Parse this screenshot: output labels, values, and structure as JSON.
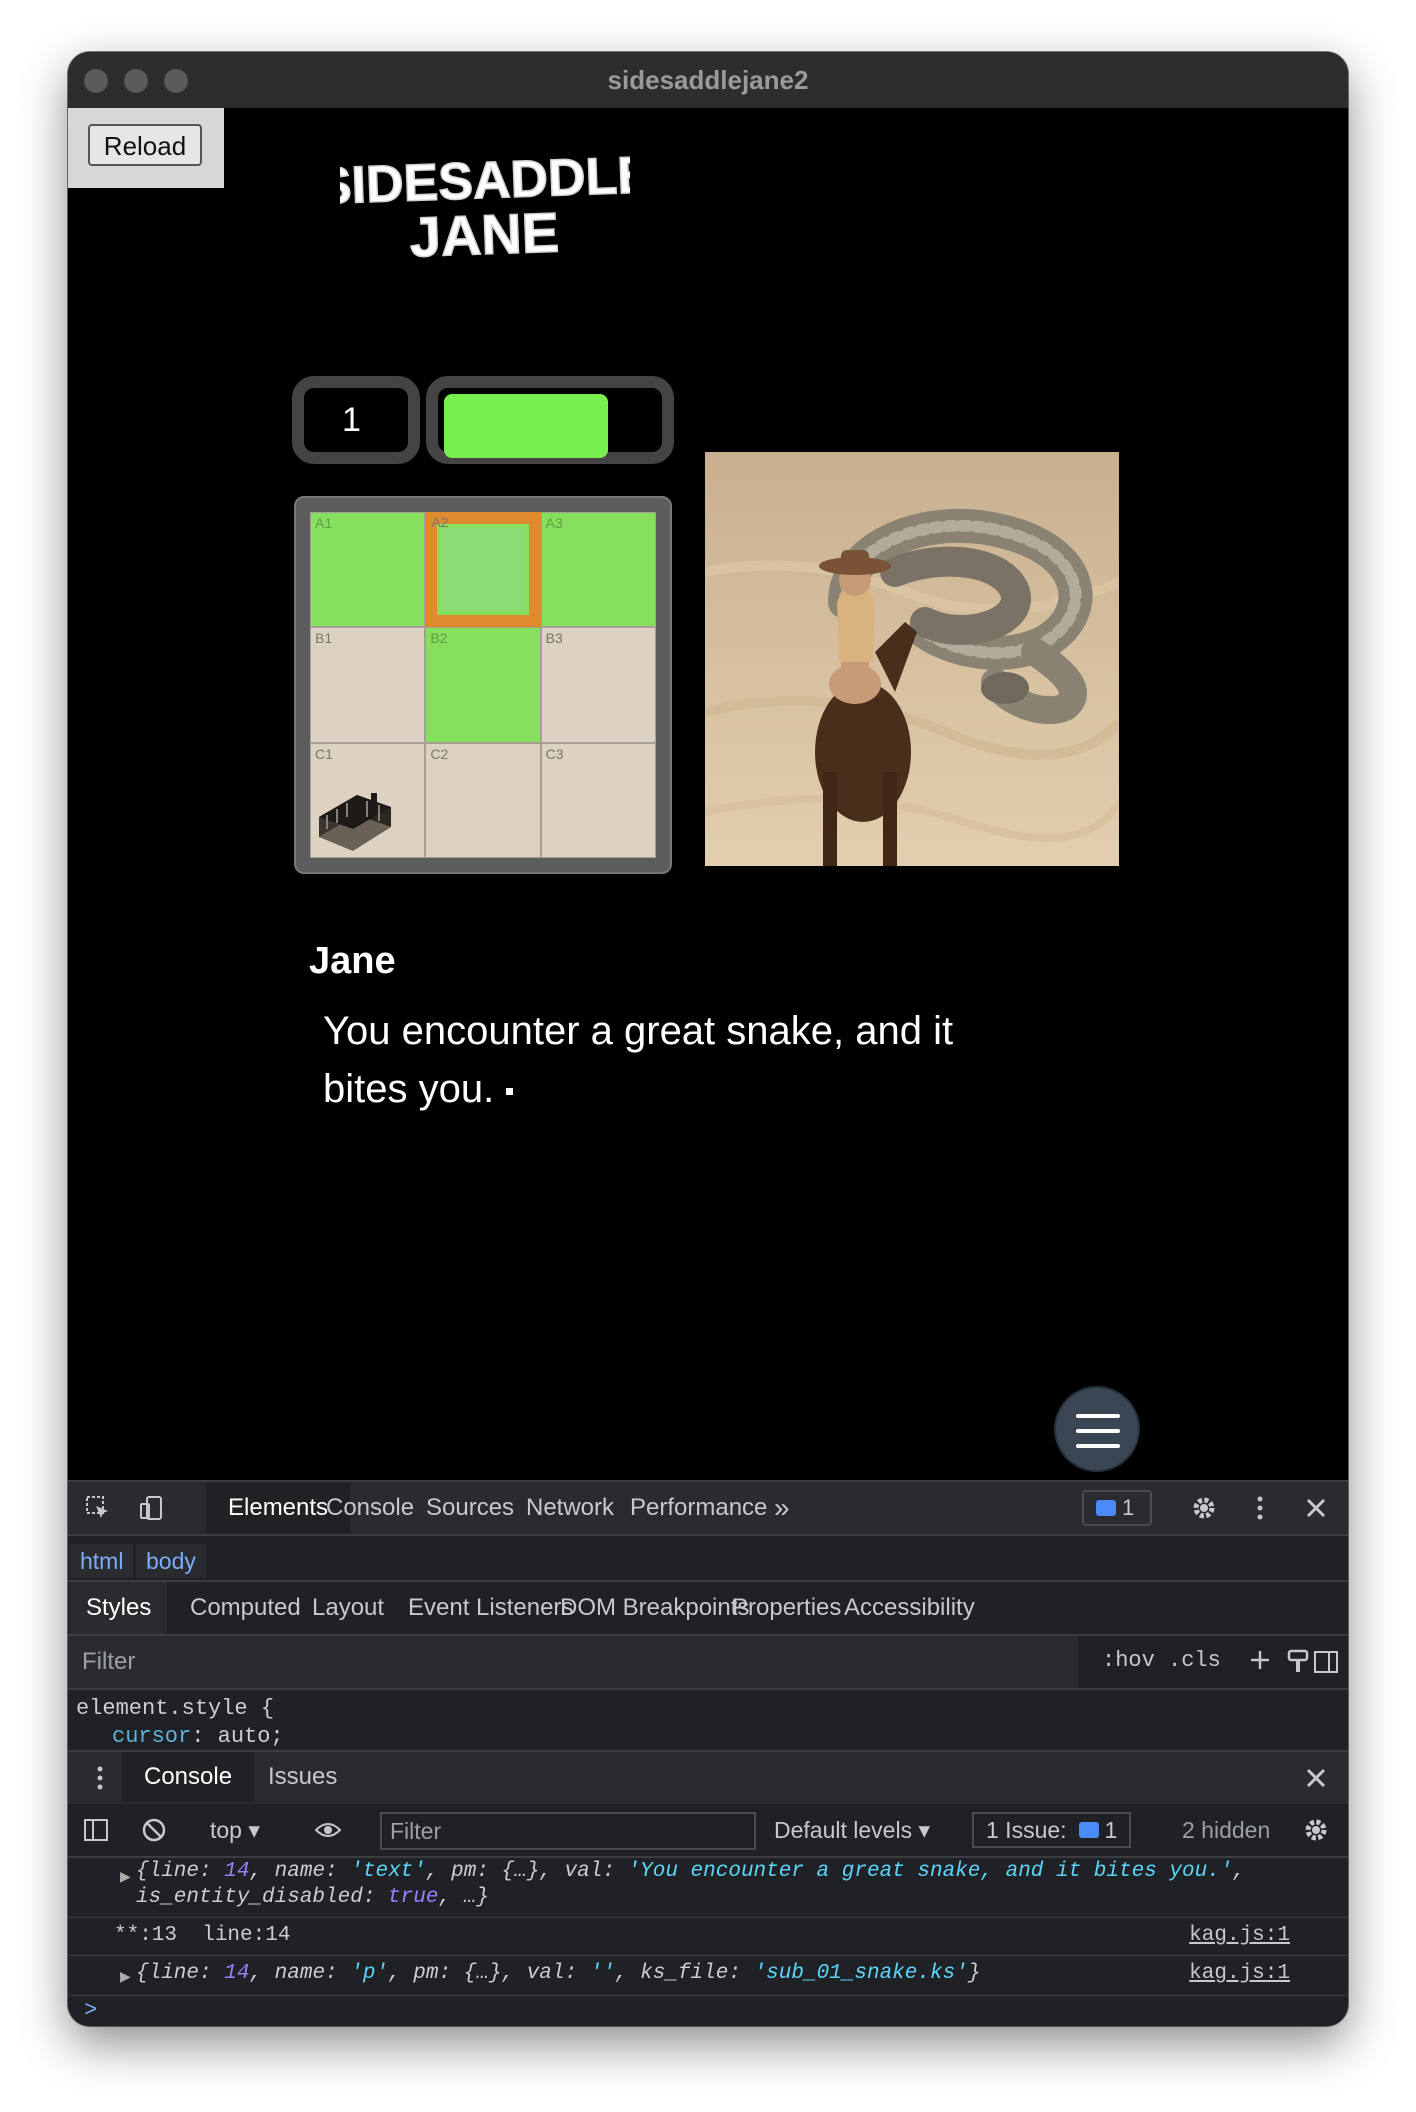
{
  "window": {
    "title": "sidesaddlejane2"
  },
  "game": {
    "reload_label": "Reload",
    "logo_line1": "SIDESADDLE",
    "logo_line2": "JANE",
    "counter": "1",
    "health_fraction": 0.82,
    "map_cells": [
      "A1",
      "A2",
      "A3",
      "B1",
      "B2",
      "B3",
      "C1",
      "C2",
      "C3"
    ],
    "current_cell": "A2",
    "speaker": "Jane",
    "message": "You encounter a great snake, and it bites you."
  },
  "devtools": {
    "tabs": [
      "Elements",
      "Console",
      "Sources",
      "Network",
      "Performance"
    ],
    "more_tabs": "»",
    "issue_count": "1",
    "breadcrumbs": [
      "html",
      "body"
    ],
    "subtabs": [
      "Styles",
      "Computed",
      "Layout",
      "Event Listeners",
      "DOM Breakpoints",
      "Properties",
      "Accessibility"
    ],
    "filter_placeholder": "Filter",
    "hov": ":hov",
    "cls": ".cls",
    "element_style_selector": "element.style {",
    "style_property": "cursor",
    "style_value": "auto;",
    "drawer_tabs": [
      "Console",
      "Issues"
    ],
    "console_context": "top",
    "console_filter_placeholder": "Filter",
    "default_levels": "Default levels",
    "issues_label": "1 Issue:",
    "issues_count": "1",
    "hidden_label": "2 hidden",
    "log": {
      "row1_line": "14",
      "row1_name": "'text'",
      "row1_val": "'You encounter a great snake, and it bites you.'",
      "row1_disabled": "true",
      "row2_text": "**:13  line:14",
      "row2_source": "kag.js:1",
      "row3_line": "14",
      "row3_name": "'p'",
      "row3_val": "''",
      "row3_file": "'sub_01_snake.ks'",
      "row3_source": "kag.js:1"
    },
    "prompt": ">"
  }
}
